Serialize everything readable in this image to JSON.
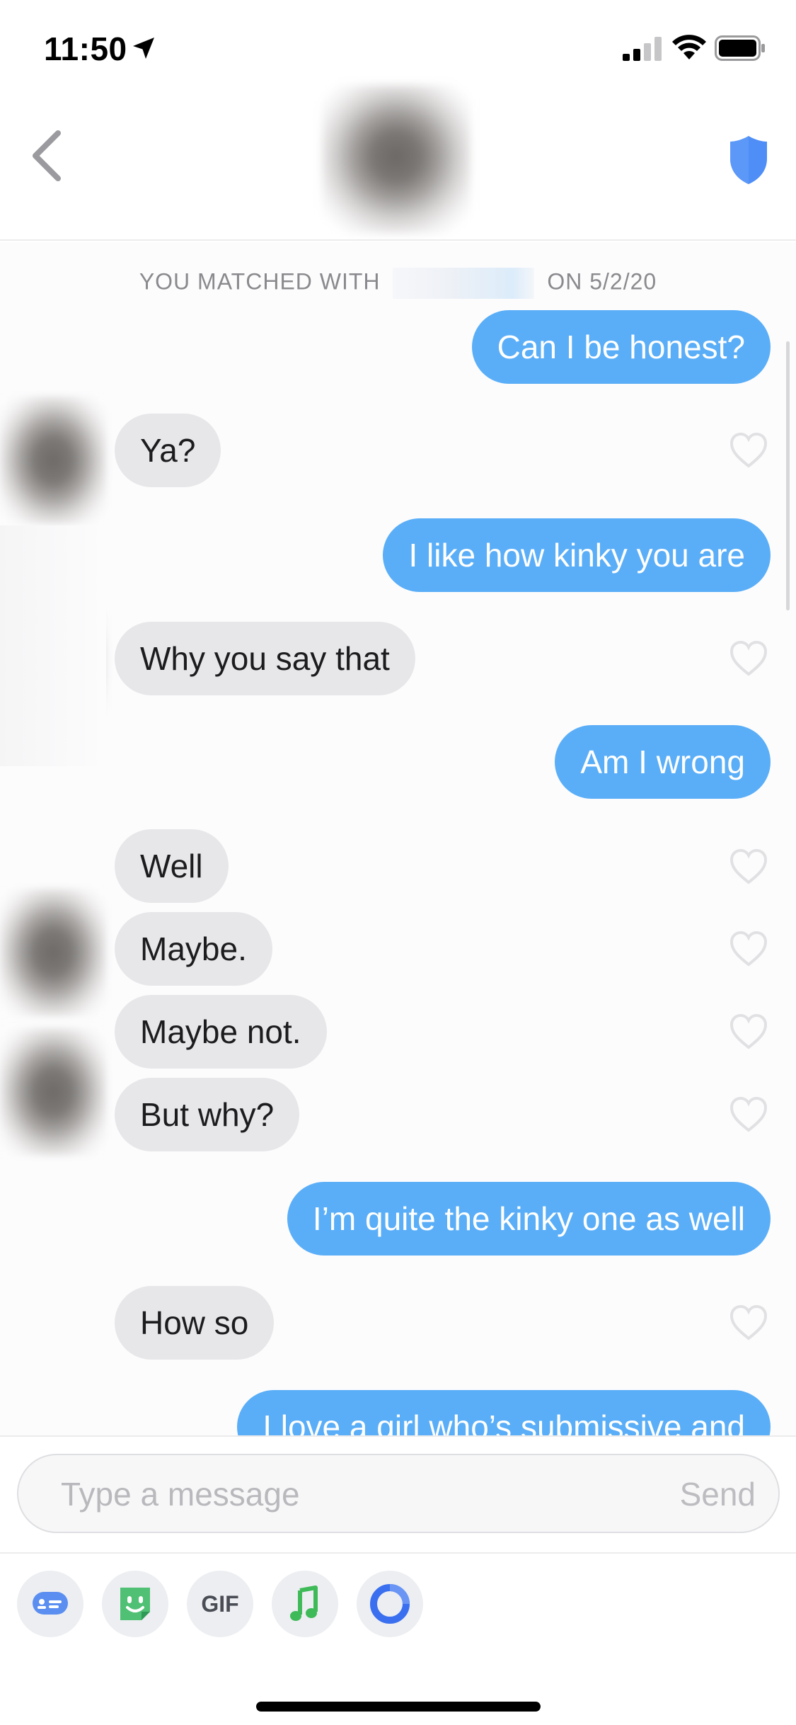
{
  "status_bar": {
    "time": "11:50"
  },
  "header": {
    "back_icon": "chevron-left-icon",
    "safety_icon": "shield-icon",
    "colors": {
      "shield": "#4f8ef7"
    }
  },
  "chat": {
    "matched_prefix": "YOU MATCHED WITH",
    "matched_suffix": "ON 5/2/20",
    "messages": [
      {
        "from": "me",
        "text": "Can I be honest?"
      },
      {
        "from": "them",
        "text": "Ya?"
      },
      {
        "from": "me",
        "text": "I like how kinky you are"
      },
      {
        "from": "them",
        "text": "Why you say that"
      },
      {
        "from": "me",
        "text": "Am I wrong"
      },
      {
        "from": "them",
        "text": "Well"
      },
      {
        "from": "them",
        "text": "Maybe."
      },
      {
        "from": "them",
        "text": "Maybe not."
      },
      {
        "from": "them",
        "text": "But why?"
      },
      {
        "from": "me",
        "text": "I’m quite the kinky one as well"
      },
      {
        "from": "them",
        "text": "How so"
      },
      {
        "from": "me",
        "text": "I love a girl who’s submissive and"
      }
    ],
    "colors": {
      "outgoing": "#5aaef7",
      "incoming": "#e7e7e9"
    }
  },
  "composer": {
    "placeholder": "Type a message",
    "send_label": "Send"
  },
  "tools": {
    "gif_label": "GIF",
    "icons": [
      "contact-card-icon",
      "sticker-icon",
      "gif-icon",
      "music-note-icon",
      "ring-icon"
    ]
  }
}
